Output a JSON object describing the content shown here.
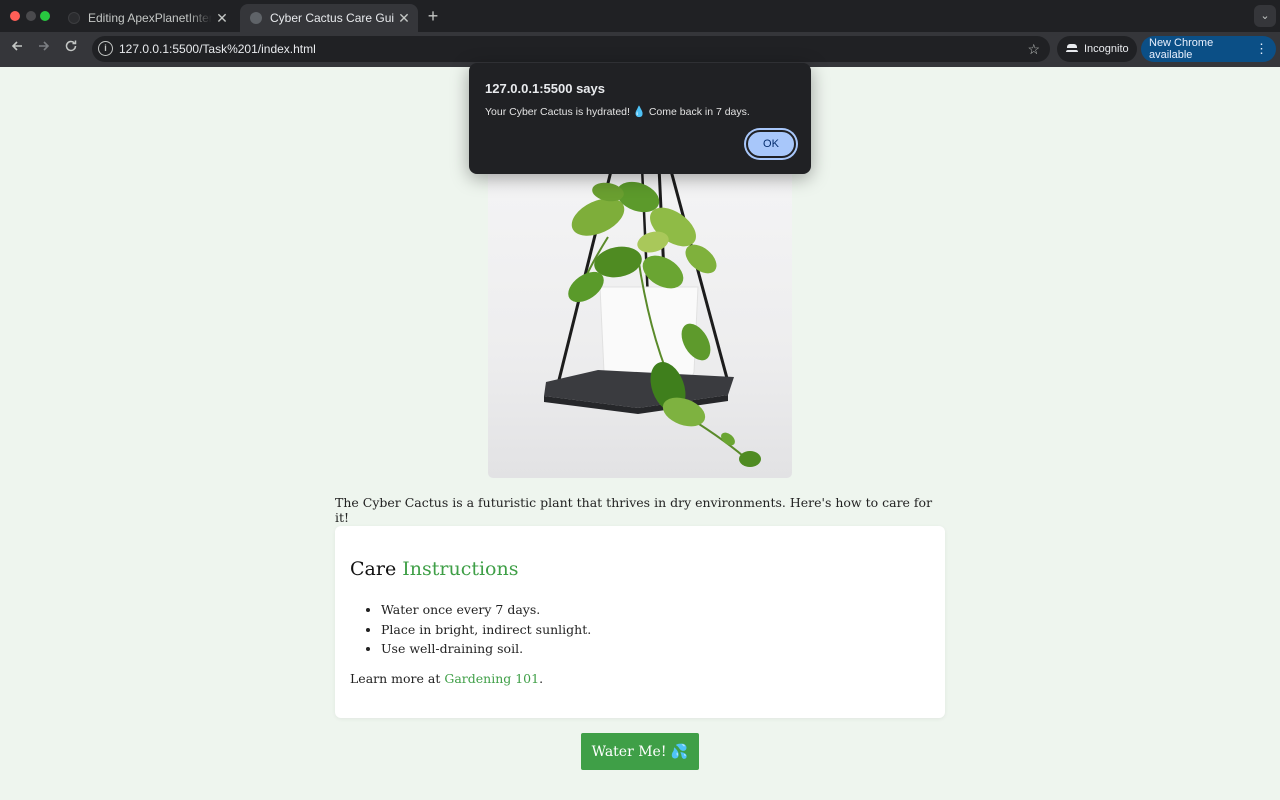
{
  "browser": {
    "tabs": [
      {
        "title": "Editing ApexPlanetInternship/",
        "active": false
      },
      {
        "title": "Cyber Cactus Care Guide",
        "active": true
      }
    ],
    "close_glyph": "✕",
    "new_tab_glyph": "+",
    "tab_search_glyph": "⌄",
    "url": "127.0.0.1:5500/Task%201/index.html",
    "incognito_label": "Incognito",
    "update_label": "New Chrome available",
    "icons": [
      "back-arrow-icon",
      "forward-arrow-icon",
      "reload-icon",
      "site-info-icon",
      "bookmark-star-icon",
      "incognito-icon",
      "kebab-menu-icon"
    ]
  },
  "page": {
    "intro": "The Cyber Cactus is a futuristic plant that thrives in dry environments. Here's how to care for it!",
    "care": {
      "title_part1": "Care",
      "title_part2": "Instructions",
      "items": [
        "Water once every 7 days.",
        "Place in bright, indirect sunlight.",
        "Use well-draining soil."
      ],
      "learn_prefix": "Learn more at",
      "learn_link": "Gardening 101",
      "learn_suffix": "."
    },
    "water_button": "Water Me! 💦",
    "accent_color": "#3f9f47",
    "background_color": "#eef5ee"
  },
  "dialog": {
    "title": "127.0.0.1:5500 says",
    "message": "Your Cyber Cactus is hydrated! 💧 Come back in 7 days.",
    "ok_label": "OK"
  }
}
